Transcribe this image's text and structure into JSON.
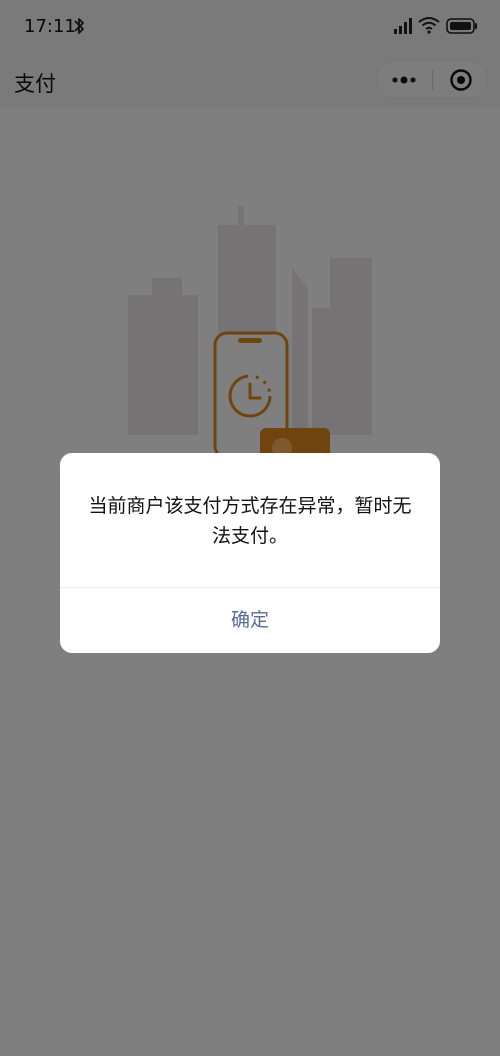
{
  "status_bar": {
    "time": "17:11",
    "icons": [
      "bluetooth-icon",
      "signal-icon",
      "wifi-icon",
      "battery-icon"
    ]
  },
  "nav": {
    "title": "支付",
    "more_icon": "more-dots-icon",
    "close_icon": "close-target-icon"
  },
  "illustration": {
    "description_icon": "city-phone-clock-illustration",
    "accent_color": "#e0891f"
  },
  "dialog": {
    "message": "当前商户该支付方式存在异常，暂时无法支付。",
    "confirm_label": "确定",
    "confirm_color": "#576b95"
  },
  "colors": {
    "overlay": "rgba(0,0,0,0.5)",
    "nav_background": "#f5f5f5"
  }
}
